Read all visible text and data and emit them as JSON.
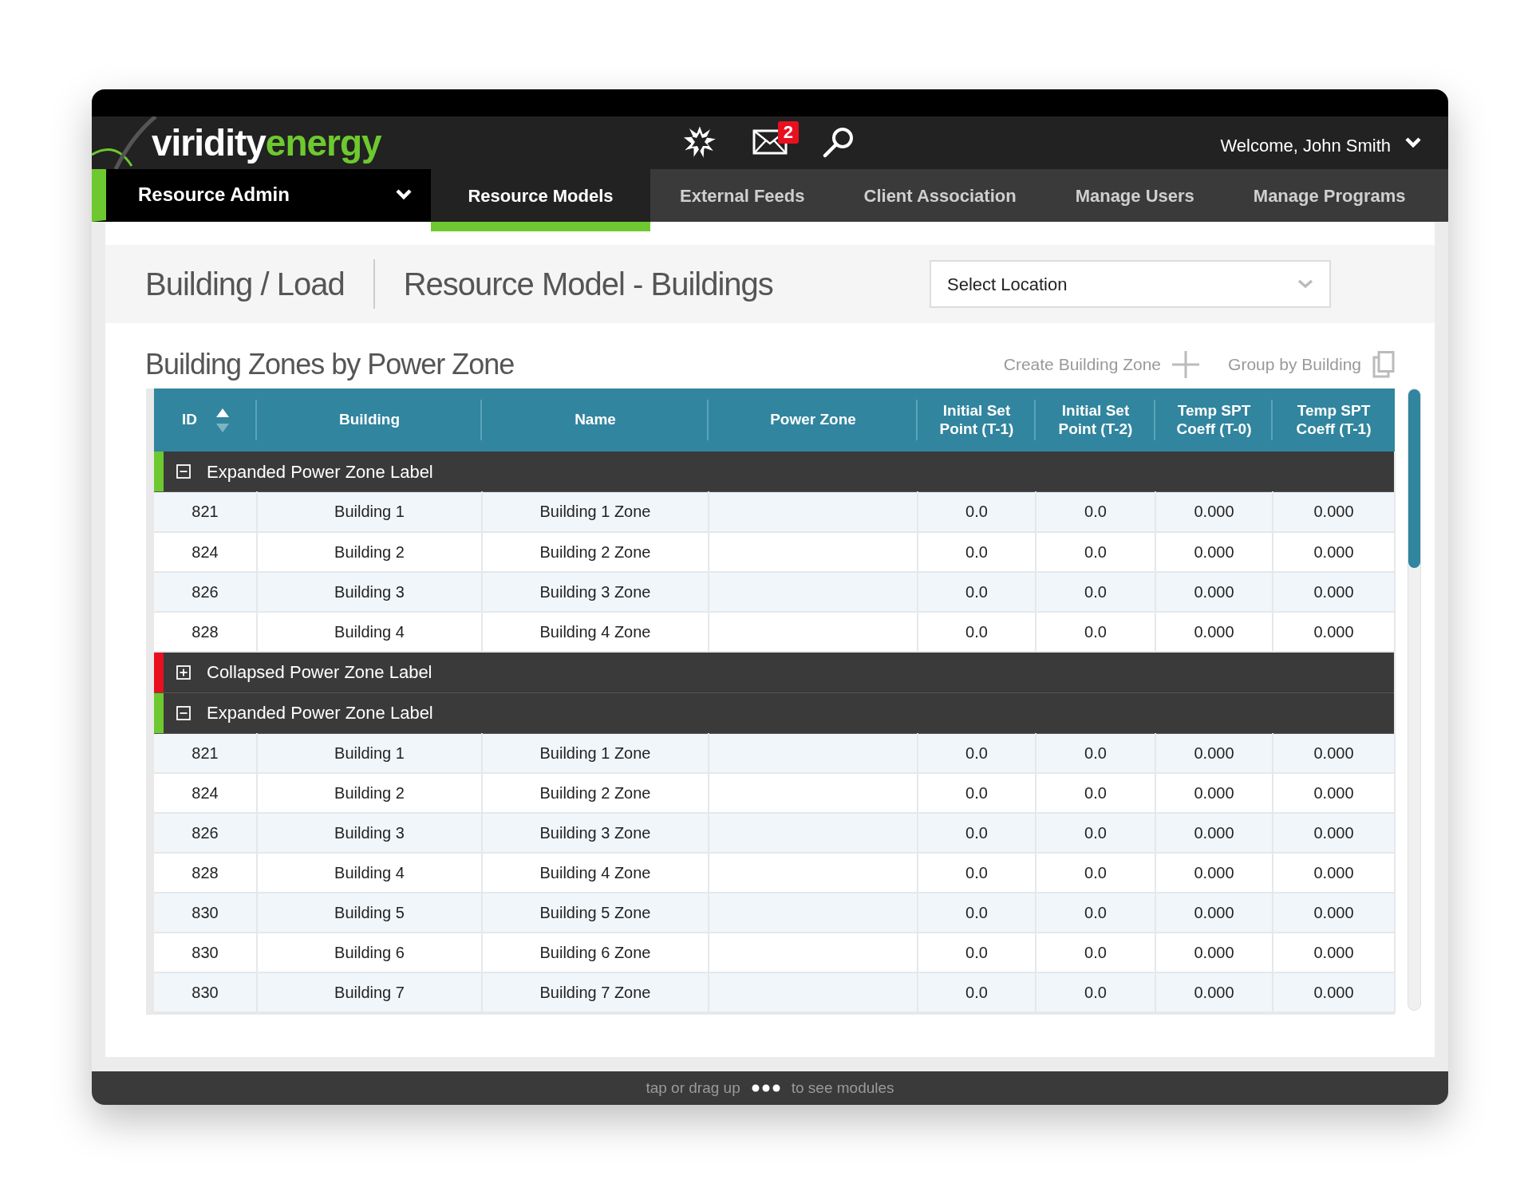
{
  "brand": {
    "name_first": "viridity",
    "name_second": "energy"
  },
  "header": {
    "mail_badge": "2",
    "welcome": "Welcome, John Smith"
  },
  "module_menu": {
    "label": "Resource Admin"
  },
  "tabs": [
    {
      "label": "Resource Models",
      "selected": true
    },
    {
      "label": "External Feeds",
      "selected": false
    },
    {
      "label": "Client Association",
      "selected": false
    },
    {
      "label": "Manage Users",
      "selected": false
    },
    {
      "label": "Manage Programs",
      "selected": false
    }
  ],
  "breadcrumb": {
    "section": "Building / Load",
    "page": "Resource Model - Buildings"
  },
  "location_select": {
    "placeholder": "Select Location"
  },
  "section_title": "Building Zones by Power Zone",
  "actions": [
    {
      "kind": "add",
      "label": "Create Building Zone"
    },
    {
      "kind": "group",
      "label": "Group by Building"
    }
  ],
  "table": {
    "columns": [
      {
        "label": "ID",
        "sorted": true
      },
      {
        "label": "Building",
        "sorted": false
      },
      {
        "label": "Name",
        "sorted": false
      },
      {
        "label": "Power Zone",
        "sorted": false
      },
      {
        "label": "Initial Set Point (T-1)",
        "sorted": false
      },
      {
        "label": "Initial Set Point (T-2)",
        "sorted": false
      },
      {
        "label": "Temp SPT Coeff (T-0)",
        "sorted": false
      },
      {
        "label": "Temp SPT Coeff (T-1)",
        "sorted": false
      }
    ],
    "groups": [
      {
        "label": "Expanded Power Zone Label",
        "expanded": true,
        "color": "#6dc92f",
        "rows": [
          [
            "821",
            "Building 1",
            "Building 1 Zone",
            null,
            "0.0",
            "0.0",
            "0.000",
            "0.000"
          ],
          [
            "824",
            "Building 2",
            "Building 2 Zone",
            null,
            "0.0",
            "0.0",
            "0.000",
            "0.000"
          ],
          [
            "826",
            "Building 3",
            "Building 3 Zone",
            null,
            "0.0",
            "0.0",
            "0.000",
            "0.000"
          ],
          [
            "828",
            "Building 4",
            "Building 4 Zone",
            null,
            "0.0",
            "0.0",
            "0.000",
            "0.000"
          ]
        ]
      },
      {
        "label": "Collapsed Power Zone Label",
        "expanded": false,
        "color": "#e8101f"
      },
      {
        "label": "Expanded Power Zone Label",
        "expanded": true,
        "color": "#6dc92f",
        "rows": [
          [
            "821",
            "Building 1",
            "Building 1 Zone",
            null,
            "0.0",
            "0.0",
            "0.000",
            "0.000"
          ],
          [
            "824",
            "Building 2",
            "Building 2 Zone",
            null,
            "0.0",
            "0.0",
            "0.000",
            "0.000"
          ],
          [
            "826",
            "Building 3",
            "Building 3 Zone",
            null,
            "0.0",
            "0.0",
            "0.000",
            "0.000"
          ],
          [
            "828",
            "Building 4",
            "Building 4 Zone",
            null,
            "0.0",
            "0.0",
            "0.000",
            "0.000"
          ],
          [
            "830",
            "Building 5",
            "Building 5 Zone",
            null,
            "0.0",
            "0.0",
            "0.000",
            "0.000"
          ],
          [
            "830",
            "Building 6",
            "Building 6 Zone",
            null,
            "0.0",
            "0.0",
            "0.000",
            "0.000"
          ],
          [
            "830",
            "Building 7",
            "Building 7 Zone",
            null,
            "0.0",
            "0.0",
            "0.000",
            "0.000"
          ]
        ]
      }
    ]
  },
  "footer": {
    "before": "tap or drag up",
    "after": "to see modules"
  }
}
